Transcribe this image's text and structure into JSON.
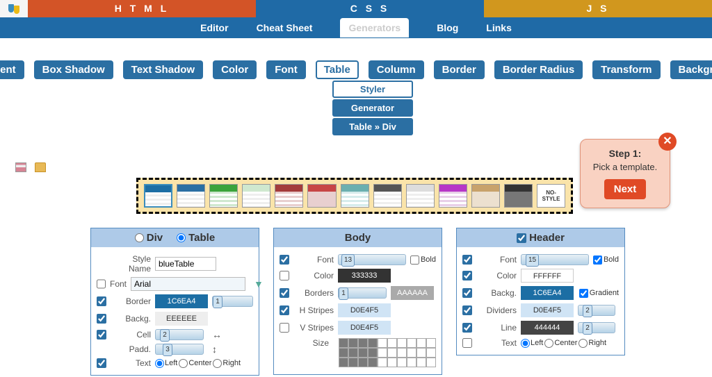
{
  "top": {
    "html": "H T M L",
    "css": "C S S",
    "js": "J S"
  },
  "nav": {
    "editor": "Editor",
    "cheat": "Cheat Sheet",
    "gen": "Generators",
    "blog": "Blog",
    "links": "Links"
  },
  "gen_buttons": {
    "gradient": "Gradient",
    "boxshadow": "Box Shadow",
    "textshadow": "Text Shadow",
    "color": "Color",
    "font": "Font",
    "table": "Table",
    "column": "Column",
    "border": "Border",
    "borderradius": "Border Radius",
    "transform": "Transform",
    "background": "Background"
  },
  "submenu": {
    "styler": "Styler",
    "generator": "Generator",
    "t2d": "Table » Div"
  },
  "popup": {
    "step": "Step 1:",
    "msg": "Pick a template.",
    "next": "Next",
    "close": "✕"
  },
  "templates_nostyle": "NO-STYLE",
  "panel_div": {
    "div_label": "Div",
    "table_label": "Table",
    "stylename_label": "Style Name",
    "stylename_value": "blueTable",
    "font_label": "Font",
    "font_value": "Arial",
    "border_label": "Border",
    "border_color": "1C6EA4",
    "border_width": "1",
    "backg_label": "Backg.",
    "backg_color": "EEEEEE",
    "cell_label": "Cell",
    "cell_val": "2",
    "padd_label": "Padd.",
    "padd_val": "3",
    "adorn_h": "↔",
    "adorn_v": "↕",
    "text_label": "Text",
    "left": "Left",
    "center": "Center",
    "right": "Right"
  },
  "panel_body": {
    "title": "Body",
    "font_label": "Font",
    "font_val": "13",
    "bold": "Bold",
    "color_label": "Color",
    "color_val": "333333",
    "borders_label": "Borders",
    "borders_val": "1",
    "borders_color": "AAAAAA",
    "hstripes_label": "H Stripes",
    "hstripes_val": "D0E4F5",
    "vstripes_label": "V Stripes",
    "vstripes_val": "D0E4F5",
    "size_label": "Size"
  },
  "panel_header": {
    "title": "Header",
    "font_label": "Font",
    "font_val": "15",
    "bold": "Bold",
    "color_label": "Color",
    "color_val": "FFFFFF",
    "backg_label": "Backg.",
    "backg_val": "1C6EA4",
    "gradient": "Gradient",
    "dividers_label": "Dividers",
    "dividers_val": "D0E4F5",
    "dividers_w": "2",
    "line_label": "Line",
    "line_val": "444444",
    "line_w": "2",
    "text_label": "Text",
    "left": "Left",
    "center": "Center",
    "right": "Right"
  }
}
